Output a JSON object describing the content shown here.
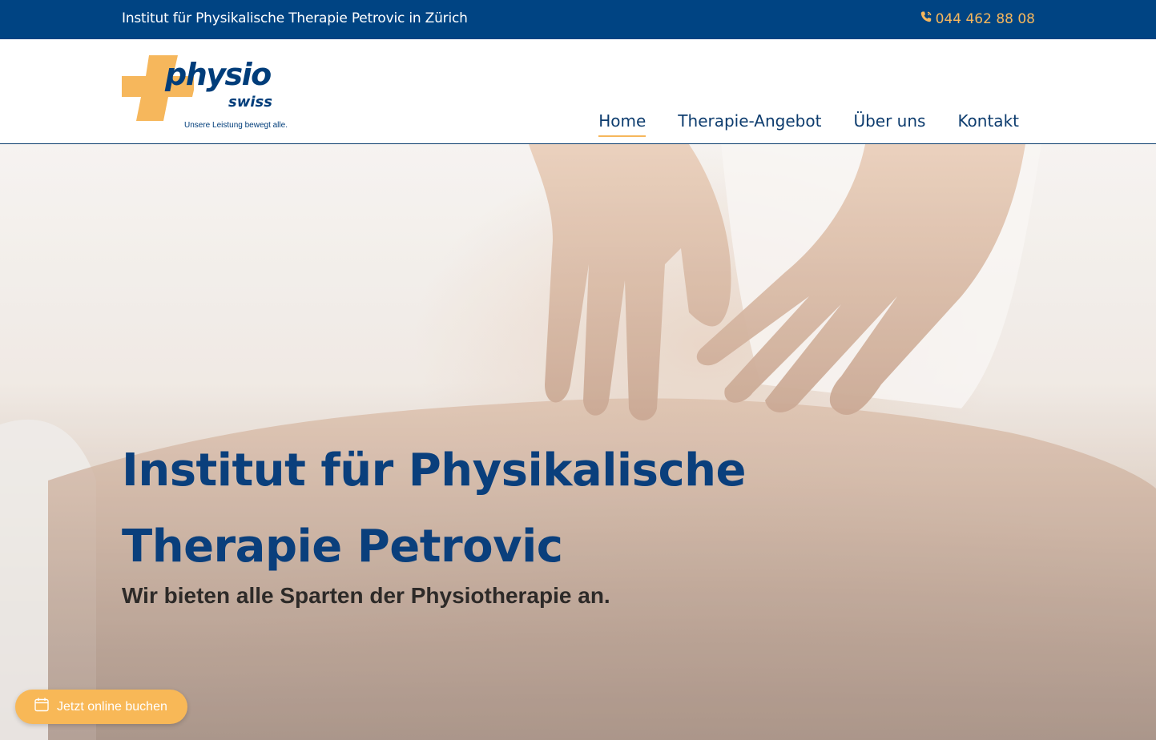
{
  "topbar": {
    "title": "Institut für Physikalische Therapie Petrovic in Zürich",
    "phone": "044 462 88 08",
    "phone_icon": "phone-icon"
  },
  "logo": {
    "word1": "physio",
    "word2": "swiss",
    "tagline": "Unsere Leistung bewegt alle."
  },
  "nav": {
    "items": [
      {
        "label": "Home",
        "active": true
      },
      {
        "label": "Therapie-Angebot",
        "active": false
      },
      {
        "label": "Über uns",
        "active": false
      },
      {
        "label": "Kontakt",
        "active": false
      }
    ]
  },
  "hero": {
    "title_line1": "Institut für Physikalische",
    "title_line2": "Therapie Petrovic",
    "subtitle": "Wir bieten alle Sparten der Physiotherapie an."
  },
  "booking": {
    "label": "Jetzt online buchen",
    "icon": "calendar-icon"
  },
  "colors": {
    "brand_blue": "#004483",
    "accent_orange": "#f6b75c",
    "nav_text": "#0d3c6e"
  }
}
